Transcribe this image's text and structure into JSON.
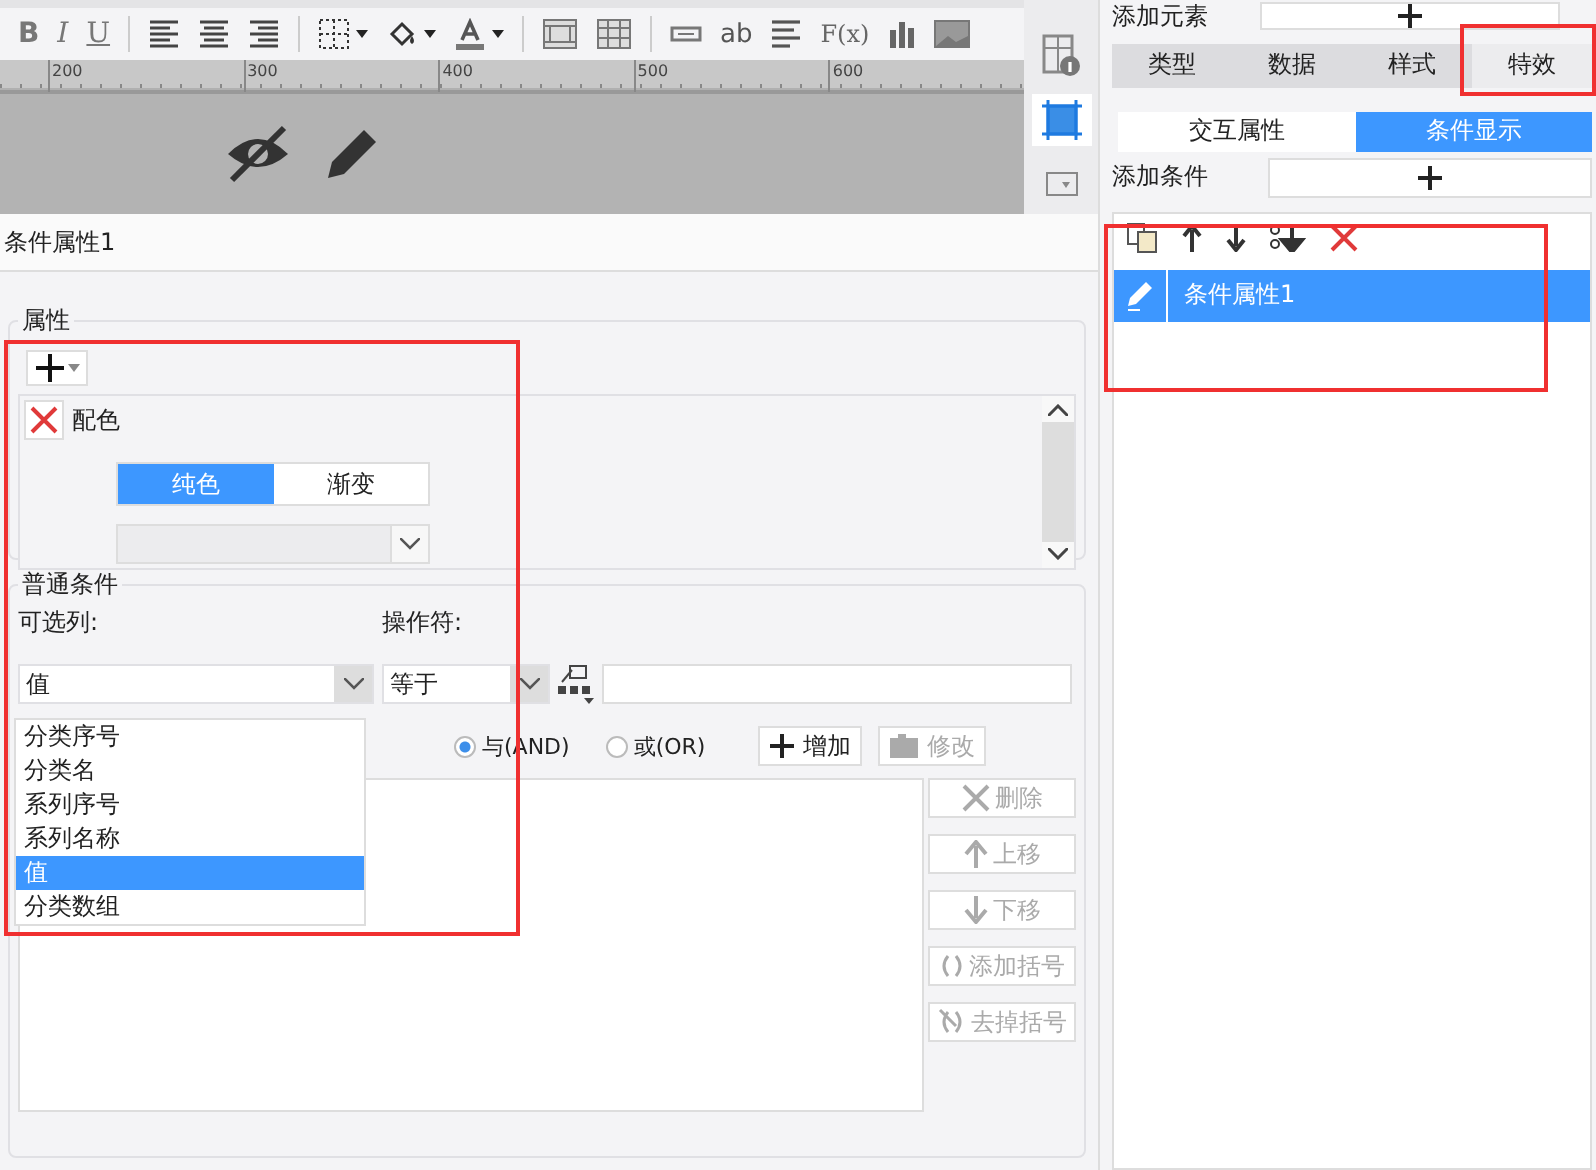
{
  "toolbar": [
    {
      "kind": "bold",
      "label": "B"
    },
    {
      "kind": "italic",
      "label": "I"
    },
    {
      "kind": "underline",
      "label": "U"
    },
    {
      "kind": "sep"
    },
    {
      "kind": "align-left"
    },
    {
      "kind": "align-center"
    },
    {
      "kind": "align-right"
    },
    {
      "kind": "sep"
    },
    {
      "kind": "border",
      "caret": true
    },
    {
      "kind": "fill",
      "caret": true
    },
    {
      "kind": "font-color",
      "caret": true
    },
    {
      "kind": "sep"
    },
    {
      "kind": "merge"
    },
    {
      "kind": "grid"
    },
    {
      "kind": "sep"
    },
    {
      "kind": "field"
    },
    {
      "kind": "text",
      "label": "ab"
    },
    {
      "kind": "lines"
    },
    {
      "kind": "formula",
      "label": "F(x)"
    },
    {
      "kind": "bars"
    },
    {
      "kind": "image"
    }
  ],
  "ruler": [
    "200",
    "300",
    "400",
    "500",
    "600"
  ],
  "side_strip": [
    {
      "kind": "info",
      "selected": false
    },
    {
      "kind": "frame",
      "selected": true
    },
    {
      "kind": "dropdown",
      "selected": false
    }
  ],
  "right_panel": {
    "add_element_label": "添加元素",
    "tabs": [
      {
        "label": "类型",
        "selected": false
      },
      {
        "label": "数据",
        "selected": false
      },
      {
        "label": "样式",
        "selected": false
      },
      {
        "label": "特效",
        "selected": true
      }
    ],
    "subtabs": [
      {
        "label": "交互属性",
        "selected": false
      },
      {
        "label": "条件显示",
        "selected": true
      }
    ],
    "add_condition_label": "添加条件",
    "conditions": [
      {
        "label": "条件属性1",
        "selected": true
      }
    ]
  },
  "editor": {
    "title": "条件属性1",
    "attributes": {
      "legend": "属性",
      "items": [
        {
          "label": "配色",
          "modes": [
            {
              "label": "纯色",
              "selected": true
            },
            {
              "label": "渐变",
              "selected": false
            }
          ]
        }
      ]
    },
    "common": {
      "legend": "普通条件",
      "column_label": "可选列:",
      "operator_label": "操作符:",
      "column_value": "值",
      "operator_value": "等于",
      "column_options": [
        {
          "label": "分类序号",
          "selected": false
        },
        {
          "label": "分类名",
          "selected": false
        },
        {
          "label": "系列序号",
          "selected": false
        },
        {
          "label": "系列名称",
          "selected": false
        },
        {
          "label": "值",
          "selected": true
        },
        {
          "label": "分类数组",
          "selected": false
        }
      ],
      "logic": [
        {
          "label": "与(AND)",
          "selected": true
        },
        {
          "label": "或(OR)",
          "selected": false
        }
      ],
      "add_button": {
        "label": "增加",
        "disabled": false
      },
      "edit_button": {
        "label": "修改",
        "disabled": true
      },
      "side_buttons": [
        {
          "kind": "delete",
          "label": "删除",
          "disabled": true
        },
        {
          "kind": "up",
          "label": "上移",
          "disabled": true
        },
        {
          "kind": "down",
          "label": "下移",
          "disabled": true
        },
        {
          "kind": "add-bracket",
          "label": "添加括号",
          "disabled": true
        },
        {
          "kind": "remove-bracket",
          "label": "去掉括号",
          "disabled": true
        }
      ]
    }
  }
}
